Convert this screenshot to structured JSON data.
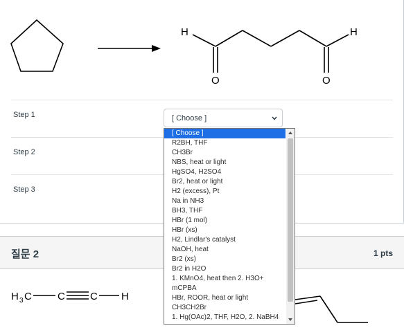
{
  "question1": {
    "molecule_labels": {
      "h_left": "H",
      "h_right": "H",
      "o_left": "O",
      "o_right": "O"
    },
    "steps": [
      {
        "label": "Step 1"
      },
      {
        "label": "Step 2"
      },
      {
        "label": "Step 3"
      }
    ],
    "select_value": "[ Choose ]"
  },
  "dropdown": {
    "options": [
      "[ Choose ]",
      "R2BH, THF",
      "CH3Br",
      "NBS, heat or light",
      "HgSO4, H2SO4",
      "Br2, heat or light",
      "H2 (excess), Pt",
      "Na in NH3",
      "BH3, THF",
      "HBr (1 mol)",
      "HBr (xs)",
      "H2, Lindlar's catalyst",
      "NaOH, heat",
      "Br2 (xs)",
      "Br2 in H2O",
      "1. KMnO4, heat then 2. H3O+",
      "mCPBA",
      "HBr, ROOR, heat or light",
      "CH3CH2Br",
      "1. Hg(OAc)2, THF, H2O, 2. NaBH4"
    ],
    "selected_index": 0
  },
  "question2": {
    "title": "질문 2",
    "points": "1 pts",
    "reactant": {
      "h3": "H",
      "sub3": "3",
      "c1": "C",
      "c2": "C",
      "h": "H"
    }
  },
  "colors": {
    "selected_bg": "#1e6fe6",
    "border": "#c7cdd1",
    "text": "#2d3b45"
  }
}
